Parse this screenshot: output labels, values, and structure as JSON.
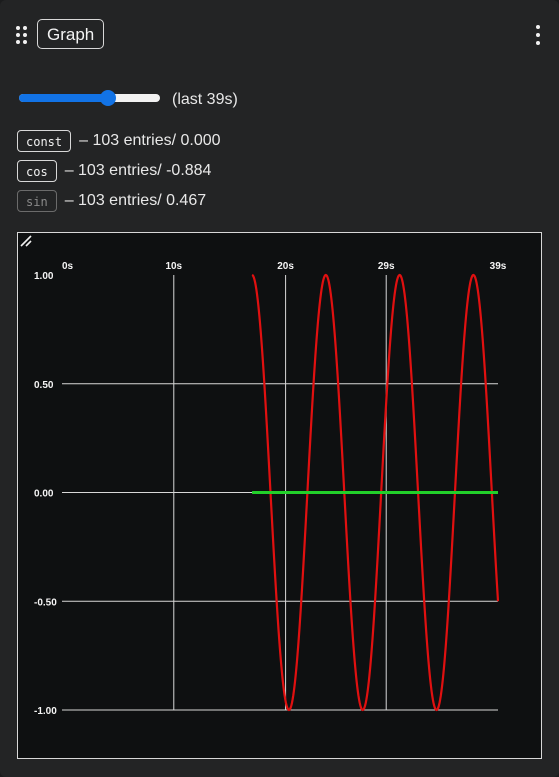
{
  "widget": {
    "title": "Graph",
    "drag_icon": "drag-handle-icon",
    "menu_icon": "more-vertical-icon"
  },
  "range": {
    "slider_fraction": 0.63,
    "label": "(last 39s)"
  },
  "series": [
    {
      "name": "const",
      "info": "– 103 entries/ 0.000",
      "active": true
    },
    {
      "name": "cos",
      "info": "– 103 entries/ -0.884",
      "active": true
    },
    {
      "name": "sin",
      "info": "– 103 entries/ 0.467",
      "active": false
    }
  ],
  "colors": {
    "accent": "#1273e6",
    "cos_line": "#e01010",
    "const_line": "#22d02a",
    "grid": "#d8d8d8"
  },
  "chart_data": {
    "type": "line",
    "x_tick_labels": [
      "0s",
      "10s",
      "20s",
      "29s",
      "39s"
    ],
    "y_tick_labels": [
      "1.00",
      "0.50",
      "0.00",
      "-0.50",
      "-1.00"
    ],
    "xlim": [
      0,
      39
    ],
    "ylim": [
      -1,
      1
    ],
    "grid": true,
    "series": [
      {
        "name": "const",
        "color": "#22d02a",
        "x": [
          17,
          39
        ],
        "y": [
          0,
          0
        ]
      },
      {
        "name": "cos",
        "color": "#e01010",
        "x_start": 17,
        "x_end": 39,
        "amplitude": 1,
        "period_s": 6.6,
        "phase_deg": 0,
        "x": [
          17,
          18,
          20,
          21.3,
          23.3,
          24.6,
          26.6,
          27.9,
          29.9,
          31.2,
          33.2,
          34.5,
          36.5,
          38.8
        ],
        "y": [
          1.0,
          0.5,
          -0.85,
          -1.0,
          0.2,
          1.0,
          -0.3,
          -1.0,
          0.45,
          1.0,
          -0.55,
          -1.0,
          0.6,
          -0.884
        ]
      }
    ]
  }
}
